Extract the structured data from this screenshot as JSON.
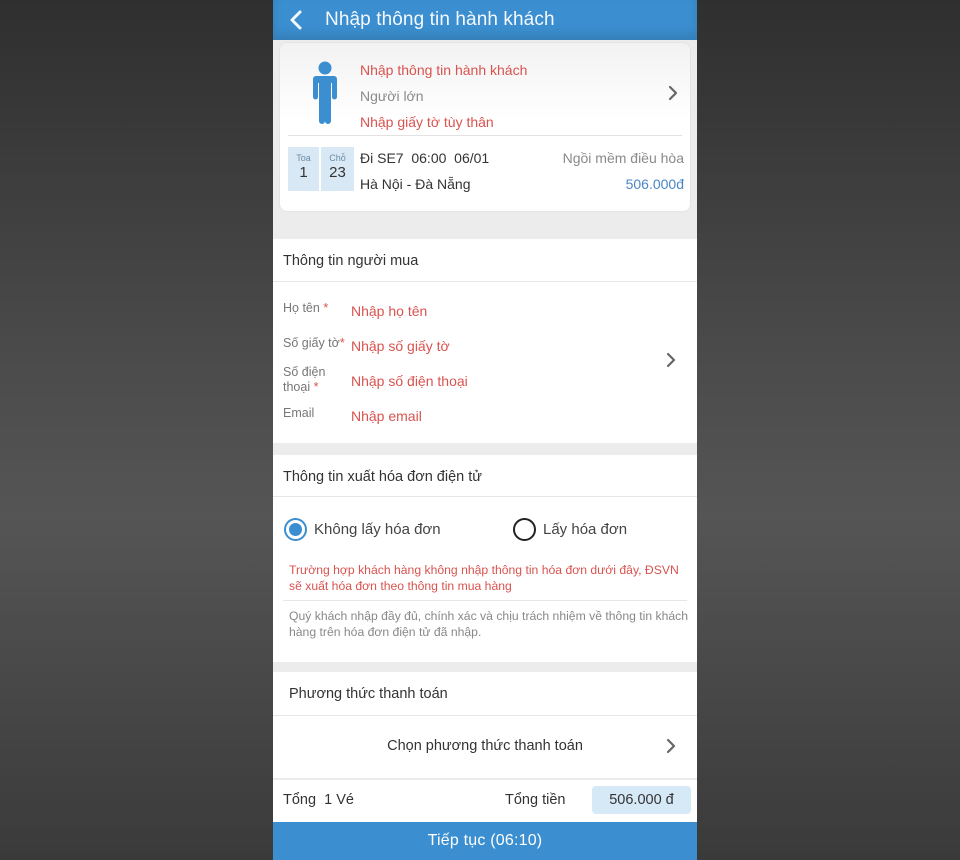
{
  "header": {
    "title": "Nhập thông tin hành khách",
    "back_icon": "chevron-left-icon"
  },
  "passenger_card": {
    "line1": "Nhập thông tin hành khách",
    "line2": "Người lớn",
    "line3": "Nhập giấy tờ tùy thân",
    "icon": "person-icon",
    "coach_label": "Toa",
    "coach_value": "1",
    "seat_label": "Chỗ",
    "seat_value": "23",
    "train_info": "Đi SE7  06:00  06/01",
    "route": "Hà Nội - Đà Nẵng",
    "seat_type": "Ngồi mềm điều hòa",
    "price": "506.000đ"
  },
  "buyer": {
    "title": "Thông tin người mua",
    "fields": [
      {
        "label": "Họ tên",
        "required": "*",
        "placeholder": "Nhập họ tên"
      },
      {
        "label": "Số giấy tờ",
        "required": "*",
        "placeholder": "Nhập số giấy tờ"
      },
      {
        "label": "Số điện thoại",
        "label_line1": "Số điện",
        "label_line2": "thoại",
        "required": "*",
        "placeholder": "Nhập số điện thoại"
      },
      {
        "label": "Email",
        "required": "",
        "placeholder": "Nhập email"
      }
    ]
  },
  "invoice": {
    "title": "Thông tin xuất hóa đơn điện tử",
    "option_no": "Không lấy hóa đơn",
    "option_yes": "Lấy hóa đơn",
    "selected": "Không lấy hóa đơn",
    "note_red": "Trường hợp khách hàng không nhập thông tin hóa đơn dưới đây, ĐSVN sẽ xuất hóa đơn theo thông tin mua hàng",
    "note_gray": "Quý khách nhập đầy đủ, chính xác và chịu trách nhiệm về thông tin khách hàng trên hóa đơn điện tử đã nhập."
  },
  "payment": {
    "title": "Phương thức thanh toán",
    "select_label": "Chọn phương thức thanh toán"
  },
  "totals": {
    "tickets": "Tổng  1 Vé",
    "total_label": "Tổng tiền",
    "total_value": "506.000 đ"
  },
  "continue_button": "Tiếp tục (06:10)",
  "colors": {
    "primary": "#3b8fd0",
    "error": "#d9534f",
    "price": "#4a86c5"
  }
}
